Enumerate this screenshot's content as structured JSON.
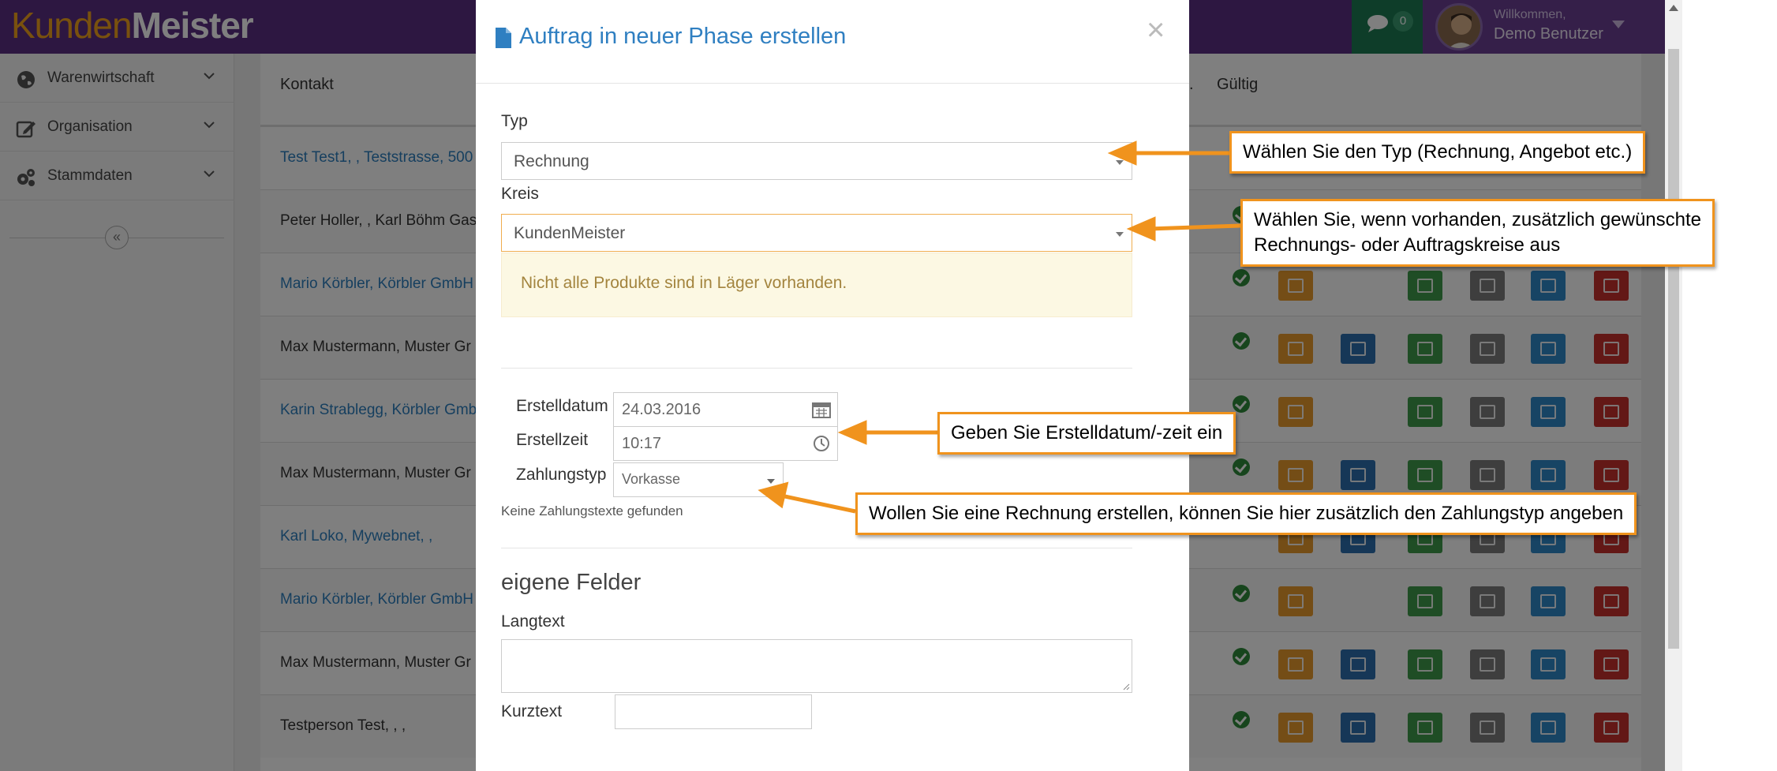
{
  "header": {
    "logo_part1": "Kunden",
    "logo_part2": "Meister",
    "chat_count": "0",
    "welcome": "Willkommen,",
    "username": "Demo Benutzer"
  },
  "sidebar": {
    "items": [
      {
        "label": "Warenwirtschaft",
        "icon": "globe-icon"
      },
      {
        "label": "Organisation",
        "icon": "edit-icon"
      },
      {
        "label": "Stammdaten",
        "icon": "cogs-icon"
      }
    ],
    "collapse_label": "«"
  },
  "table": {
    "headers": {
      "contact": "Kontakt",
      "partial": ".",
      "valid": "Gültig"
    },
    "rows": [
      {
        "contact": "Test Test1, , Teststrasse, 500",
        "link": true,
        "ok": false,
        "buttons": []
      },
      {
        "contact": "Peter Holler, , Karl Böhm Gas",
        "link": false,
        "ok": true,
        "buttons": []
      },
      {
        "contact": "Mario Körbler, Körbler GmbH",
        "link": true,
        "ok": true,
        "buttons": [
          "fwd",
          "save",
          "print",
          "edit",
          "del"
        ]
      },
      {
        "contact": "Max Mustermann, Muster Gr",
        "link": false,
        "ok": true,
        "buttons": [
          "fwd",
          "mail",
          "save",
          "print",
          "edit",
          "del"
        ]
      },
      {
        "contact": "Karin Strablegg, Körbler GmbH",
        "link": true,
        "ok": true,
        "buttons": [
          "fwd",
          "save",
          "print",
          "edit",
          "del"
        ]
      },
      {
        "contact": "Max Mustermann, Muster Gr",
        "link": false,
        "ok": true,
        "buttons": [
          "fwd",
          "mail",
          "save",
          "print",
          "edit",
          "del"
        ]
      },
      {
        "contact": "Karl Loko, Mywebnet, ,",
        "link": true,
        "ok": false,
        "buttons": [
          "fwd",
          "mail",
          "save",
          "print",
          "edit",
          "del"
        ]
      },
      {
        "contact": "Mario Körbler, Körbler GmbH",
        "link": true,
        "ok": true,
        "buttons": [
          "fwd",
          "save",
          "print",
          "edit",
          "del"
        ]
      },
      {
        "contact": "Max Mustermann, Muster Gr",
        "link": false,
        "ok": true,
        "buttons": [
          "fwd",
          "mail",
          "save",
          "print",
          "edit",
          "del"
        ]
      },
      {
        "contact": "Testperson Test, , ,",
        "link": false,
        "ok": true,
        "buttons": [
          "fwd",
          "mail",
          "save",
          "print",
          "edit",
          "del"
        ]
      }
    ]
  },
  "modal": {
    "title": "Auftrag in neuer Phase erstellen",
    "close": "×",
    "typ_label": "Typ",
    "typ_value": "Rechnung",
    "kreis_label": "Kreis",
    "kreis_value": "KundenMeister",
    "warning": "Nicht alle Produkte sind in Läger vorhanden.",
    "erstelldatum_label": "Erstelldatum",
    "erstelldatum_value": "24.03.2016",
    "erstellzeit_label": "Erstellzeit",
    "erstellzeit_value": "10:17",
    "zahlungstyp_label": "Zahlungstyp",
    "zahlungstyp_value": "Vorkasse",
    "no_payment_texts": "Keine Zahlungstexte gefunden",
    "custom_fields_heading": "eigene Felder",
    "langtext_label": "Langtext",
    "kurztext_label": "Kurztext"
  },
  "callouts": {
    "typ": "Wählen Sie den Typ (Rechnung, Angebot etc.)",
    "kreis_line1": "Wählen Sie, wenn vorhanden, zusätzlich gewünschte",
    "kreis_line2": "Rechnungs- oder Auftragskreise aus",
    "datum": "Geben Sie Erstelldatum/-zeit ein",
    "zahlung": "Wollen Sie eine Rechnung erstellen, können Sie hier zusätzlich den Zahlungstyp angeben"
  },
  "colors": {
    "brand_purple": "#5a2f82",
    "brand_orange": "#f3a31c",
    "link_blue": "#2f7fc1",
    "callout_orange": "#f0931d"
  }
}
